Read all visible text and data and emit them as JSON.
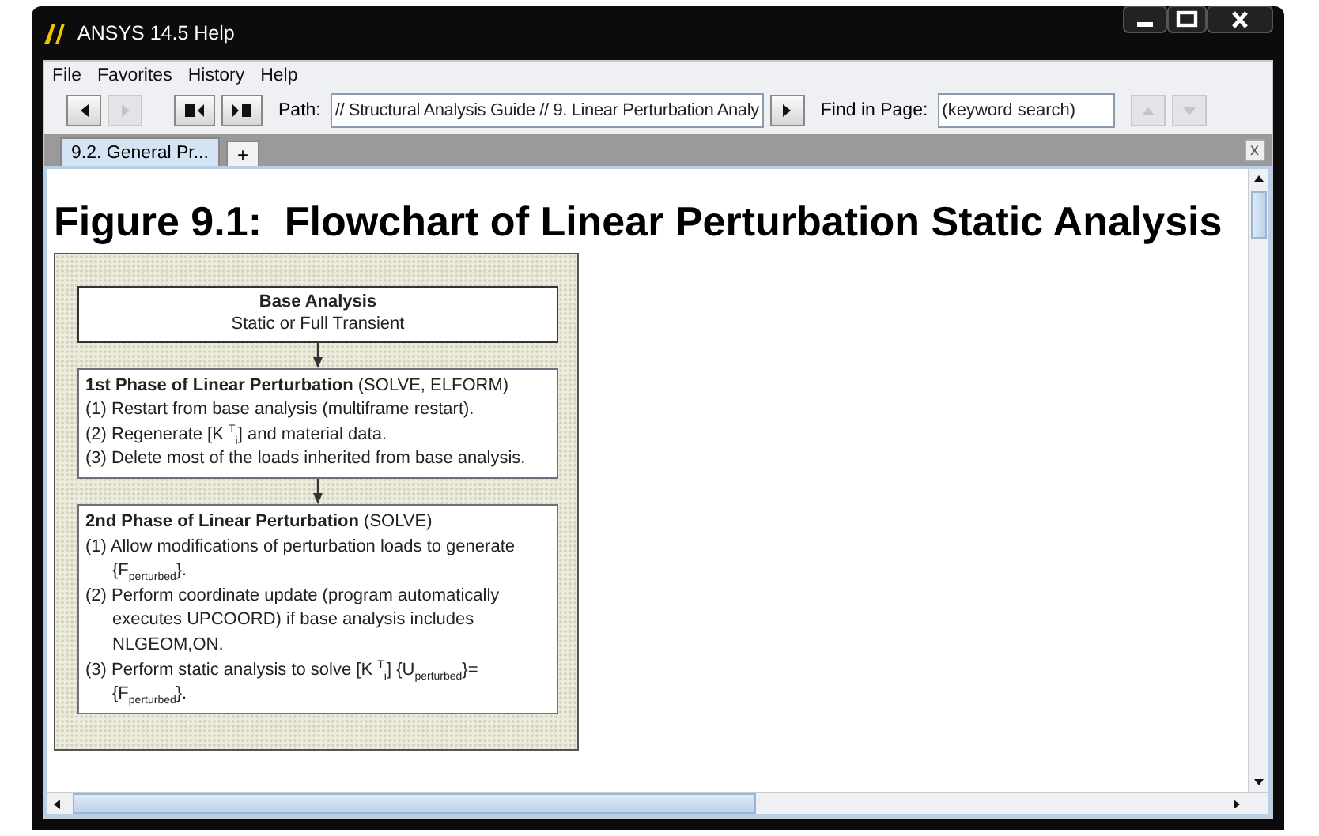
{
  "window": {
    "title": "ANSYS 14.5 Help"
  },
  "menu": [
    "File",
    "Favorites",
    "History",
    "Help"
  ],
  "toolbar": {
    "buttons": [
      {
        "kind": "back",
        "disabled": false
      },
      {
        "kind": "forward",
        "disabled": true
      },
      {
        "kind": "prev-topic",
        "disabled": false
      },
      {
        "kind": "next-topic",
        "disabled": false
      }
    ],
    "path_label": "Path:",
    "path": "// Structural Analysis Guide // 9. Linear Perturbation Analy",
    "find_label": "Find in Page:",
    "find_placeholder": "(keyword search)",
    "find_buttons": [
      {
        "kind": "up",
        "disabled": true
      },
      {
        "kind": "down",
        "disabled": true
      }
    ]
  },
  "tabs": [
    {
      "label": "9.2. General Pr...",
      "selected": true
    }
  ],
  "new_tab": "+",
  "close_tab": "x",
  "content": {
    "heading": "Figure 9.1:  Flowchart of Linear Perturbation Static Analysis",
    "flowchart": {
      "boxes": [
        {
          "kind": "centered",
          "title": "Base Analysis",
          "subtitle": "Static or Full Transient"
        },
        {
          "kind": "steps",
          "title": "1st Phase of Linear Perturbation",
          "note": "(SOLVE, ELFORM)",
          "steps": [
            "(1) Restart from base analysis (multiframe restart).",
            "(2) Regenerate [K $^{T}$$_{i}$] and material data.",
            "(3) Delete most of the loads inherited from base analysis."
          ]
        },
        {
          "kind": "steps",
          "title": "2nd Phase of Linear Perturbation",
          "note": "(SOLVE)",
          "steps": [
            "(1) Allow modifications of perturbation loads to generate {F$_{perturbed}$}.",
            "(2) Perform coordinate update (program automatically executes UPCOORD) if base analysis includes NLGEOM,ON.",
            "(3) Perform static analysis to solve [K $^{T}$$_{i}$] {U$_{perturbed}$}={F$_{perturbed}$}."
          ]
        }
      ]
    }
  }
}
